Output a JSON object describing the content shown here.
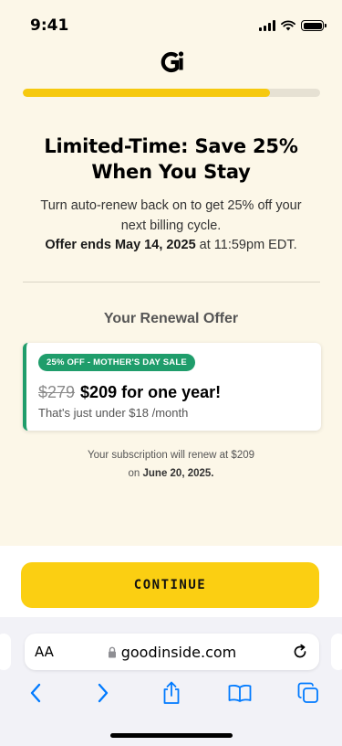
{
  "status_bar": {
    "time": "9:41"
  },
  "progress": {
    "fraction": 0.83,
    "color": "#f6c90e"
  },
  "headline": {
    "line1": "Limited-Time: Save 25%",
    "line2": "When You Stay"
  },
  "intro": {
    "line1": "Turn auto-renew back on to get 25% off your",
    "line2": "next billing cycle.",
    "deadline_bold": "Offer ends May 14, 2025",
    "deadline_rest": " at 11:59pm EDT."
  },
  "offer": {
    "heading": "Your Renewal Offer",
    "badge": "25% OFF - MOTHER'S DAY SALE",
    "old_price": "$279",
    "new_price": "$209 for one year!",
    "note": "That's just under $18 /month",
    "accent": "#1f9d6b"
  },
  "renewal_note": {
    "line1": "Your subscription will renew at $209",
    "prefix": "on ",
    "date": "June 20, 2025."
  },
  "continue_button": {
    "label": "CONTINUE",
    "color": "#fbcf12"
  },
  "browser": {
    "text_size_label": "AA",
    "url": "goodinside.com",
    "icons": [
      "lock-icon",
      "reload-icon",
      "back-icon",
      "forward-icon",
      "share-icon",
      "bookmarks-icon",
      "tabs-icon"
    ]
  }
}
